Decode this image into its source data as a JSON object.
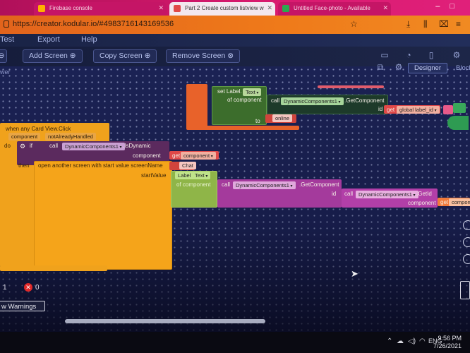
{
  "browser": {
    "tabs": [
      {
        "label": "Firebase console"
      },
      {
        "label": "Part 2 Create custom listview w"
      },
      {
        "label": "Untitled Face-photo - Available"
      }
    ],
    "url": "https://creator.kodular.io/#4983716143169536"
  },
  "menu": {
    "items": [
      "Test",
      "Export",
      "Help"
    ]
  },
  "toolbar": {
    "add_screen": "Add Screen ⊕",
    "copy_screen": "Copy Screen ⊕",
    "remove_screen": "Remove Screen ⊗",
    "designer": "Designer",
    "blocks": "Block",
    "power": "wer"
  },
  "blocks": {
    "set_label": "set Label.",
    "text_prop": "Text",
    "of_component": "of component",
    "call": "call",
    "dyn_components": "DynamicComponents1",
    "get_component": ".GetComponent",
    "id": "id",
    "get": "get",
    "global_label_id": "global label_id",
    "to": "to",
    "online": "online",
    "when_card_view": "when any Card View.Click",
    "component": "component",
    "not_already_handled": "notAlreadyHandled",
    "do": "do",
    "if": "if",
    "is_dynamic": ".IsDynamic",
    "then": "then",
    "open_screen": "open another screen with start value  screenName",
    "chat": "Chat",
    "start_value": "startValue",
    "label": "Label",
    "text": "Text",
    "get_id": ".GetId",
    "compone": "compone"
  },
  "warnings": {
    "count_a": "1",
    "count_b": "0",
    "show_label": "w Warnings"
  },
  "taskbar": {
    "lang": "ENG",
    "time": "9:56 PM",
    "date": "7/26/2021"
  }
}
